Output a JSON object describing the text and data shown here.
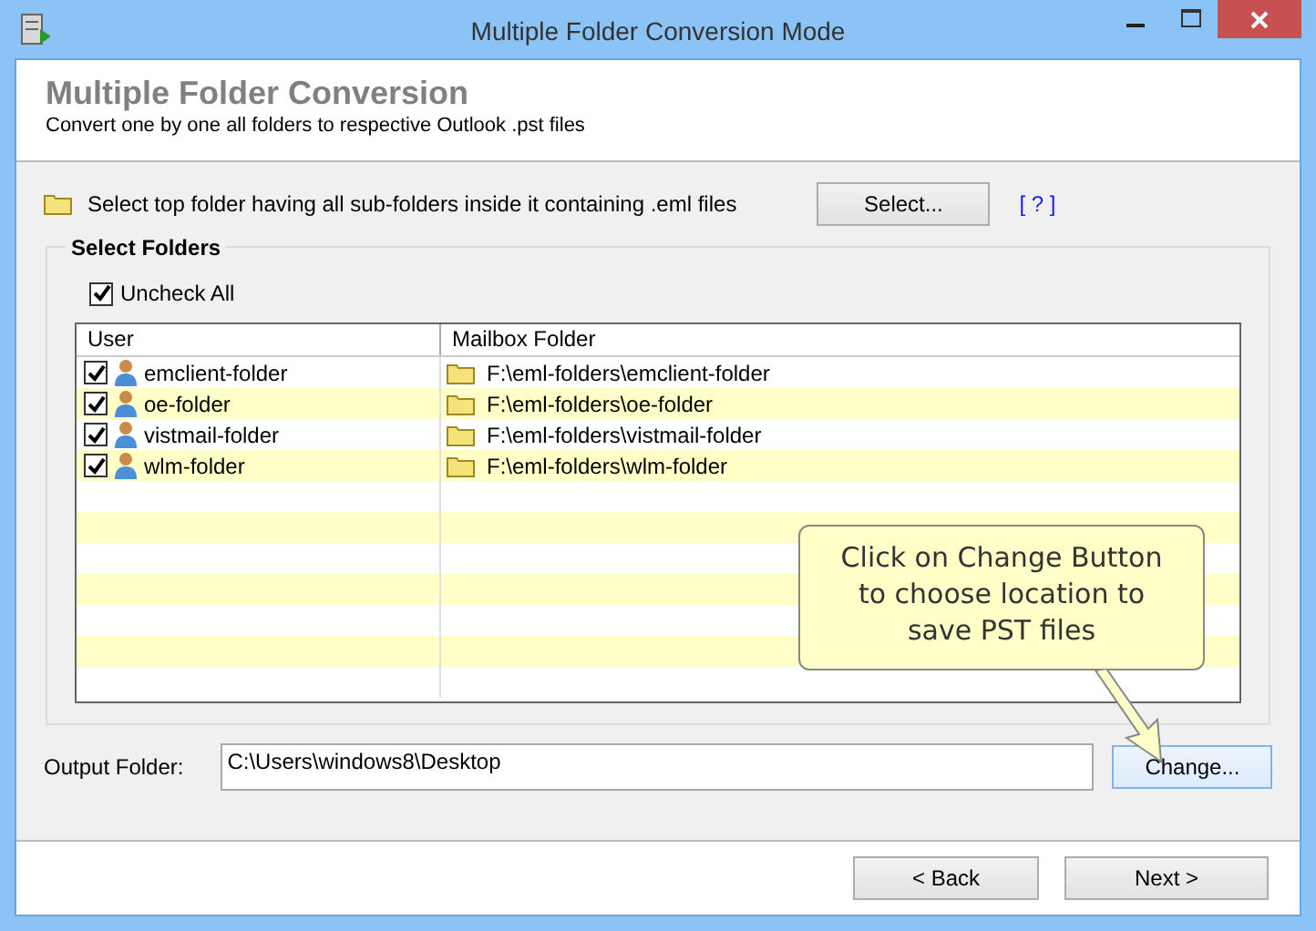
{
  "window": {
    "title": "Multiple Folder Conversion Mode"
  },
  "header": {
    "title": "Multiple Folder Conversion",
    "subtitle": "Convert one by one all folders to respective Outlook .pst files"
  },
  "top_folder": {
    "label": "Select top folder having all sub-folders inside it containing .eml files",
    "button": "Select...",
    "help": "[ ? ]"
  },
  "select_folders": {
    "title": "Select Folders",
    "uncheck_all": {
      "label": "Uncheck All",
      "checked": true
    },
    "columns": [
      "User",
      "Mailbox Folder"
    ],
    "rows": [
      {
        "user": "emclient-folder",
        "folder": "F:\\eml-folders\\emclient-folder",
        "checked": true
      },
      {
        "user": "oe-folder",
        "folder": "F:\\eml-folders\\oe-folder",
        "checked": true
      },
      {
        "user": "vistmail-folder",
        "folder": "F:\\eml-folders\\vistmail-folder",
        "checked": true
      },
      {
        "user": "wlm-folder",
        "folder": "F:\\eml-folders\\wlm-folder",
        "checked": true
      }
    ]
  },
  "callout": "Click on Change Button to choose location to save PST files",
  "output": {
    "label": "Output Folder:",
    "value": "C:\\Users\\windows8\\Desktop",
    "button": "Change..."
  },
  "buttons": [
    "< Back",
    "Next >"
  ]
}
